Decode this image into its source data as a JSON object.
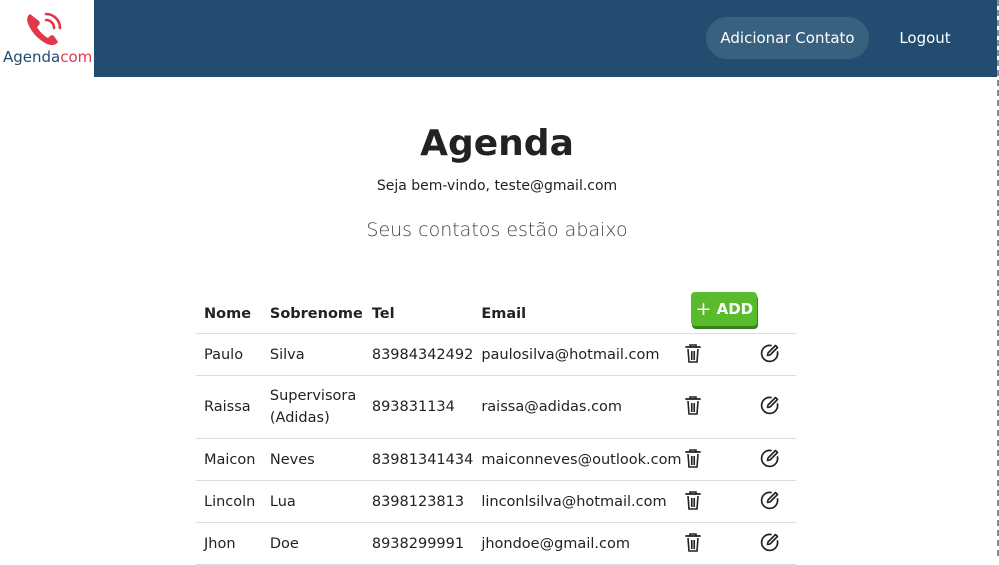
{
  "logo": {
    "part1": "Agenda",
    "part2": "com"
  },
  "nav": {
    "add_contact": "Adicionar Contato",
    "logout": "Logout"
  },
  "page": {
    "title": "Agenda",
    "welcome": "Seja bem-vindo, teste@gmail.com",
    "subtitle": "Seus contatos estão abaixo"
  },
  "table": {
    "headers": {
      "nome": "Nome",
      "sobrenome": "Sobrenome",
      "tel": "Tel",
      "email": "Email"
    },
    "add_button": "ADD",
    "rows": [
      {
        "nome": "Paulo",
        "sobrenome": "Silva",
        "tel": "83984342492",
        "email": "paulosilva@hotmail.com"
      },
      {
        "nome": "Raissa",
        "sobrenome": "Supervisora (Adidas)",
        "tel": "893831134",
        "email": "raissa@adidas.com"
      },
      {
        "nome": "Maicon",
        "sobrenome": "Neves",
        "tel": "83981341434",
        "email": "maiconneves@outlook.com"
      },
      {
        "nome": "Lincoln",
        "sobrenome": "Lua",
        "tel": "8398123813",
        "email": "linconlsilva@hotmail.com"
      },
      {
        "nome": "Jhon",
        "sobrenome": "Doe",
        "tel": "8938299991",
        "email": "jhondoe@gmail.com"
      }
    ]
  },
  "icons": {
    "delete": "trash-icon",
    "edit": "edit-icon",
    "logo": "phone-icon"
  },
  "colors": {
    "navbar": "#234d70",
    "nav_button": "#38607f",
    "add_button": "#58bb2c",
    "logo_accent": "#e2384c"
  }
}
